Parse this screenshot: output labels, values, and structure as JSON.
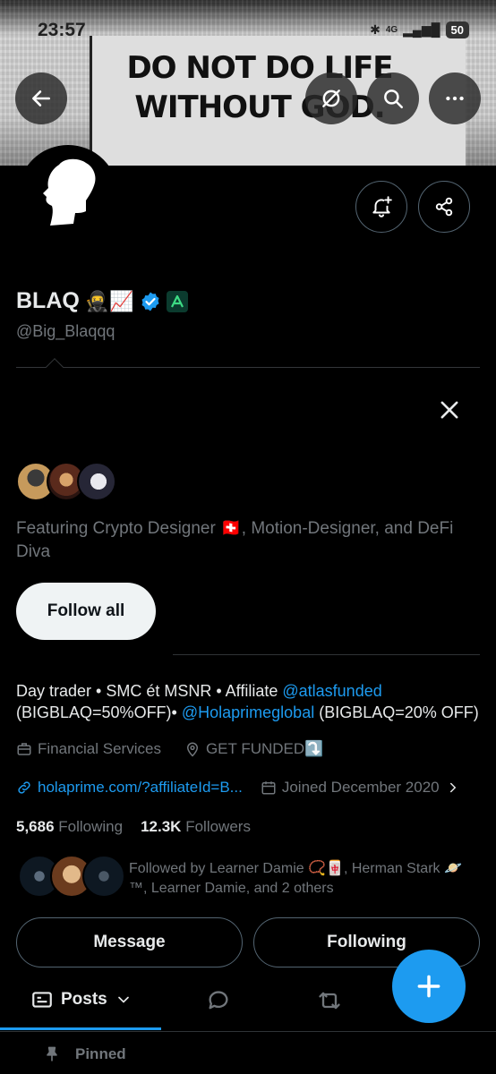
{
  "status_bar": {
    "time": "23:57",
    "network": "4G",
    "battery": "50"
  },
  "banner": {
    "slogan": "DO NOT DO LIFE WITHOUT GOD."
  },
  "profile": {
    "name": "BLAQ",
    "name_emojis": "🥷📈",
    "handle": "@Big_Blaqqq",
    "bio_parts": {
      "p1": "Day trader • SMC ét MSNR • Affiliate ",
      "mention1": "@atlasfunded",
      "p2": " (BIGBLAQ=50%OFF)• ",
      "mention2": "@Holaprimeglobal",
      "p3": " (BIGBLAQ=20% OFF)"
    },
    "category": "Financial Services",
    "location": "GET FUNDED⤵️",
    "website": "holaprime.com/?affiliateId=B...",
    "joined": "Joined December 2020",
    "following_count": "5,686",
    "following_label": "Following",
    "followers_count": "12.3K",
    "followers_label": "Followers",
    "followed_by": "Followed by Learner Damie 📿🀄, Herman Stark 🪐™, Learner Damie, and 2 others"
  },
  "suggestions": {
    "text": "Featuring Crypto Designer 🇨🇭, Motion-Designer, and DeFi Diva",
    "follow_all_label": "Follow all"
  },
  "actions": {
    "message_label": "Message",
    "following_label": "Following"
  },
  "tabs": {
    "posts_label": "Posts"
  },
  "pinned_label": "Pinned",
  "colors": {
    "accent": "#1d9bf0",
    "verified": "#1d9bf0",
    "muted": "#71767b"
  }
}
